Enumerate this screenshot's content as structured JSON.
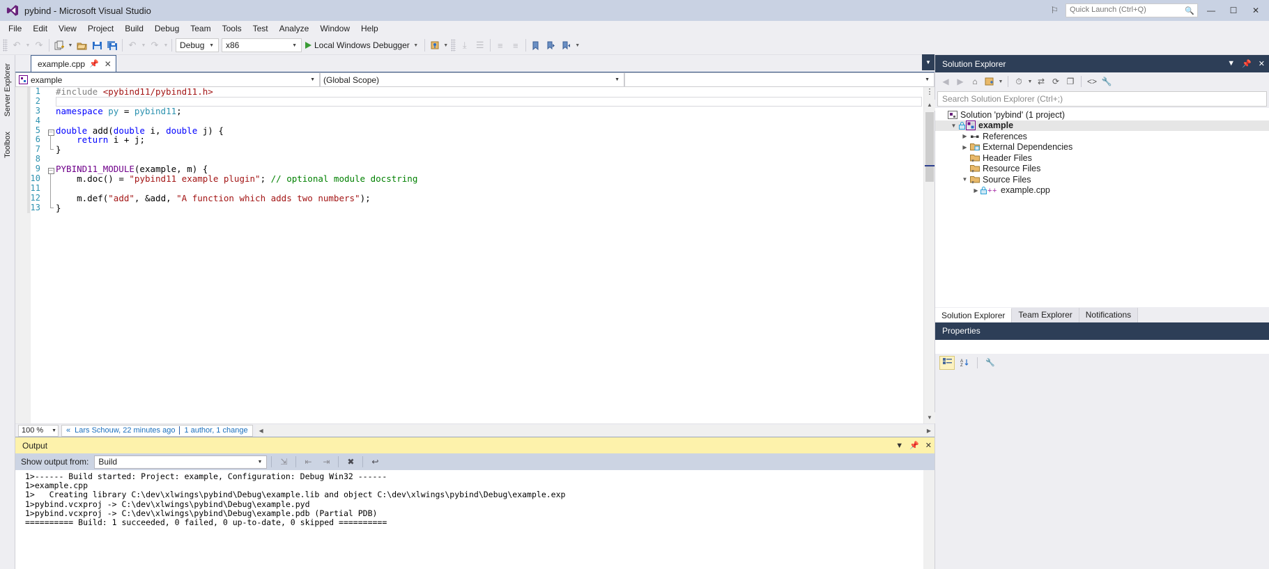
{
  "titlebar": {
    "app_title": "pybind - Microsoft Visual Studio",
    "logo_icon": "visual-studio-logo",
    "flag_icon": "feedback-flag-icon",
    "quick_launch_placeholder": "Quick Launch (Ctrl+Q)",
    "quick_launch_value": "",
    "search_icon": "search-icon",
    "minimize": "—",
    "maximize": "☐",
    "close": "✕"
  },
  "menubar": {
    "items": [
      {
        "label": "File"
      },
      {
        "label": "Edit"
      },
      {
        "label": "View"
      },
      {
        "label": "Project"
      },
      {
        "label": "Build"
      },
      {
        "label": "Debug"
      },
      {
        "label": "Team"
      },
      {
        "label": "Tools"
      },
      {
        "label": "Test"
      },
      {
        "label": "Analyze"
      },
      {
        "label": "Window"
      },
      {
        "label": "Help"
      }
    ]
  },
  "toolbar": {
    "nav_back_icon": "navigate-back-icon",
    "nav_forward_icon": "navigate-forward-icon",
    "new_project_icon": "new-project-icon",
    "open_file_icon": "open-file-icon",
    "save_icon": "save-icon",
    "save_all_icon": "save-all-icon",
    "undo_icon": "undo-icon",
    "redo_icon": "redo-icon",
    "configuration": "Debug",
    "platform": "x86",
    "run_label": "Local Windows Debugger",
    "run_icon": "play-icon",
    "attach_icon": "attach-to-process-icon",
    "step_icon": "step-into-icon",
    "comment_icon": "comment-selection-icon",
    "uncomment_icon": "uncomment-selection-icon",
    "indent_icon": "indent-icon",
    "outdent_icon": "outdent-icon",
    "bookmark_icon": "bookmark-icon",
    "next_bookmark_icon": "next-bookmark-icon",
    "prev_bookmark_icon": "previous-bookmark-icon"
  },
  "leftdock": {
    "tabs": [
      {
        "label": "Server Explorer",
        "name": "server-explorer"
      },
      {
        "label": "Toolbox",
        "name": "toolbox"
      }
    ]
  },
  "editor": {
    "tab_label": "example.cpp",
    "tab_pin_icon": "pin-icon",
    "tab_close_icon": "close-icon",
    "scope_left": "example",
    "scope_right": "(Global Scope)",
    "scope_far_right": "",
    "scope_icon": "cpp-project-icon",
    "lines": [
      {
        "num": "1",
        "fold": "none",
        "text": "#include <pybind11/pybind11.h>"
      },
      {
        "num": "2",
        "fold": "none",
        "text": ""
      },
      {
        "num": "3",
        "fold": "none",
        "text": "namespace py = pybind11;"
      },
      {
        "num": "4",
        "fold": "none",
        "text": ""
      },
      {
        "num": "5",
        "fold": "start",
        "text": "double add(double i, double j) {"
      },
      {
        "num": "6",
        "fold": "mid",
        "text": "    return i + j;"
      },
      {
        "num": "7",
        "fold": "end",
        "text": "}"
      },
      {
        "num": "8",
        "fold": "none",
        "text": ""
      },
      {
        "num": "9",
        "fold": "start",
        "text": "PYBIND11_MODULE(example, m) {"
      },
      {
        "num": "10",
        "fold": "mid",
        "text": "    m.doc() = \"pybind11 example plugin\"; // optional module docstring"
      },
      {
        "num": "11",
        "fold": "mid",
        "text": ""
      },
      {
        "num": "12",
        "fold": "mid",
        "text": "    m.def(\"add\", &add, \"A function which adds two numbers\");"
      },
      {
        "num": "13",
        "fold": "end",
        "text": "}"
      }
    ]
  },
  "editor_status": {
    "zoom": "100 %",
    "blame_chevron_icon": "blame-chevron-icon",
    "blame_author": "Lars Schouw, 22 minutes ago",
    "blame_changes": "1 author, 1 change",
    "scroll_left_icon": "scroll-left-icon",
    "scroll_right_icon": "scroll-right-icon"
  },
  "output": {
    "title": "Output",
    "dropdown_icon": "chevron-down-icon",
    "pin_icon": "pin-icon",
    "close_icon": "close-icon",
    "show_output_from_label": "Show output from:",
    "source": "Build",
    "find_message_icon": "find-message-icon",
    "go_to_previous_icon": "go-to-previous-message-icon",
    "go_to_next_icon": "go-to-next-message-icon",
    "clear_all_icon": "clear-all-icon",
    "toggle_wordwrap_icon": "toggle-word-wrap-icon",
    "lines": [
      "1>------ Build started: Project: example, Configuration: Debug Win32 ------",
      "1>example.cpp",
      "1>   Creating library C:\\dev\\xlwings\\pybind\\Debug\\example.lib and object C:\\dev\\xlwings\\pybind\\Debug\\example.exp",
      "1>pybind.vcxproj -> C:\\dev\\xlwings\\pybind\\Debug\\example.pyd",
      "1>pybind.vcxproj -> C:\\dev\\xlwings\\pybind\\Debug\\example.pdb (Partial PDB)",
      "========== Build: 1 succeeded, 0 failed, 0 up-to-date, 0 skipped =========="
    ]
  },
  "solution_explorer": {
    "title": "Solution Explorer",
    "title_dropdown_icon": "chevron-down-icon",
    "title_pin_icon": "pin-icon",
    "title_close_icon": "close-icon",
    "toolbar": {
      "back_icon": "back-icon",
      "forward_icon": "forward-icon",
      "home_icon": "home-icon",
      "pending_changes_icon": "pending-changes-filter-icon",
      "sync_icon": "sync-with-active-document-icon",
      "refresh_icon": "refresh-icon",
      "collapse_all_icon": "collapse-all-icon",
      "show_all_files_icon": "show-all-files-icon",
      "code_view_icon": "view-code-icon",
      "properties_icon": "properties-wrench-icon"
    },
    "search_placeholder": "Search Solution Explorer (Ctrl+;)",
    "tree": [
      {
        "label": "Solution 'pybind' (1 project)",
        "depth": 0,
        "expander": "none",
        "icon": "solution-icon",
        "bold": false,
        "selected": false
      },
      {
        "label": "example",
        "depth": 1,
        "expander": "expanded",
        "icon": "cpp-project-icon",
        "bold": true,
        "selected": true
      },
      {
        "label": "References",
        "depth": 2,
        "expander": "collapsed",
        "icon": "references-icon",
        "bold": false,
        "selected": false
      },
      {
        "label": "External Dependencies",
        "depth": 2,
        "expander": "collapsed",
        "icon": "folder-ext-icon",
        "bold": false,
        "selected": false
      },
      {
        "label": "Header Files",
        "depth": 2,
        "expander": "none",
        "icon": "filter-folder-icon",
        "bold": false,
        "selected": false
      },
      {
        "label": "Resource Files",
        "depth": 2,
        "expander": "none",
        "icon": "filter-folder-icon",
        "bold": false,
        "selected": false
      },
      {
        "label": "Source Files",
        "depth": 2,
        "expander": "expanded",
        "icon": "filter-folder-icon",
        "bold": false,
        "selected": false
      },
      {
        "label": "example.cpp",
        "depth": 3,
        "expander": "collapsed",
        "icon": "cpp-file-icon",
        "bold": false,
        "selected": false
      }
    ],
    "tabs": [
      {
        "label": "Solution Explorer",
        "active": true
      },
      {
        "label": "Team Explorer",
        "active": false
      },
      {
        "label": "Notifications",
        "active": false
      }
    ]
  },
  "properties": {
    "title": "Properties",
    "categorized_icon": "categorized-view-icon",
    "alphabetical_icon": "alphabetical-sort-icon",
    "property_pages_icon": "property-pages-wrench-icon"
  },
  "colors": {
    "titlebar_bg": "#c9d2e3",
    "chrome_bg": "#eeeef2",
    "panel_title_bg": "#2d3e57",
    "output_title_bg": "#fdf2ab",
    "output_toolbar_bg": "#ccd4e3",
    "editor_bg": "#ffffff",
    "linenum_fg": "#2b91af",
    "string_fg": "#a31515",
    "keyword_fg": "#0000ff",
    "comment_fg": "#008000",
    "macro_fg": "#6f008a",
    "preprocessor_fg": "#808080",
    "run_green": "#3a9b35",
    "link_blue": "#1a6fbd"
  }
}
